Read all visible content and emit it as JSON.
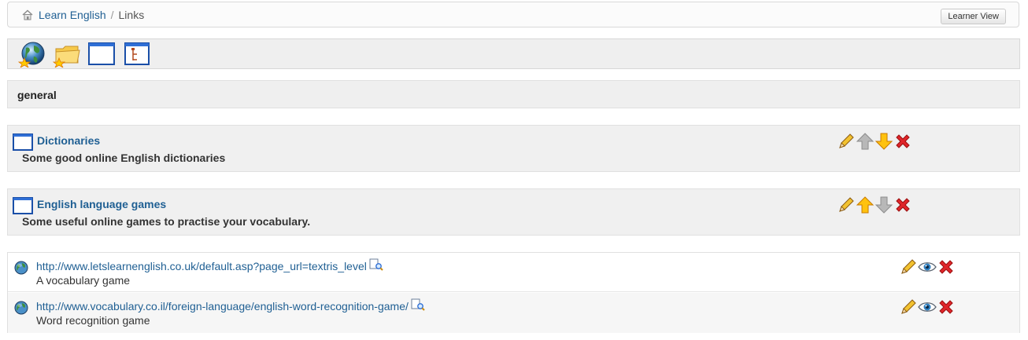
{
  "breadcrumb": {
    "home_icon": "home-icon",
    "items": [
      "Learn English",
      "Links"
    ],
    "separator": "/"
  },
  "header": {
    "learner_view_label": "Learner View"
  },
  "toolbar": {
    "buttons": [
      "add-link-icon",
      "add-category-icon",
      "window-icon",
      "tree-view-icon"
    ]
  },
  "category": {
    "name": "general"
  },
  "folders": [
    {
      "title": "Dictionaries",
      "description": "Some good online English dictionaries",
      "up_enabled": false,
      "down_enabled": true
    },
    {
      "title": "English language games",
      "description": "Some useful online games to practise your vocabulary.",
      "up_enabled": true,
      "down_enabled": false
    }
  ],
  "links": [
    {
      "url": "http://www.letslearnenglish.co.uk/default.asp?page_url=textris_level",
      "description": "A vocabulary game"
    },
    {
      "url": "http://www.vocabulary.co.il/foreign-language/english-word-recognition-game/",
      "description": "Word recognition game"
    }
  ],
  "colors": {
    "link": "#1f5f93",
    "panel": "#efefef",
    "arrow_active": "#f5b400",
    "arrow_disabled": "#b5b5b5",
    "delete": "#e0252a"
  }
}
